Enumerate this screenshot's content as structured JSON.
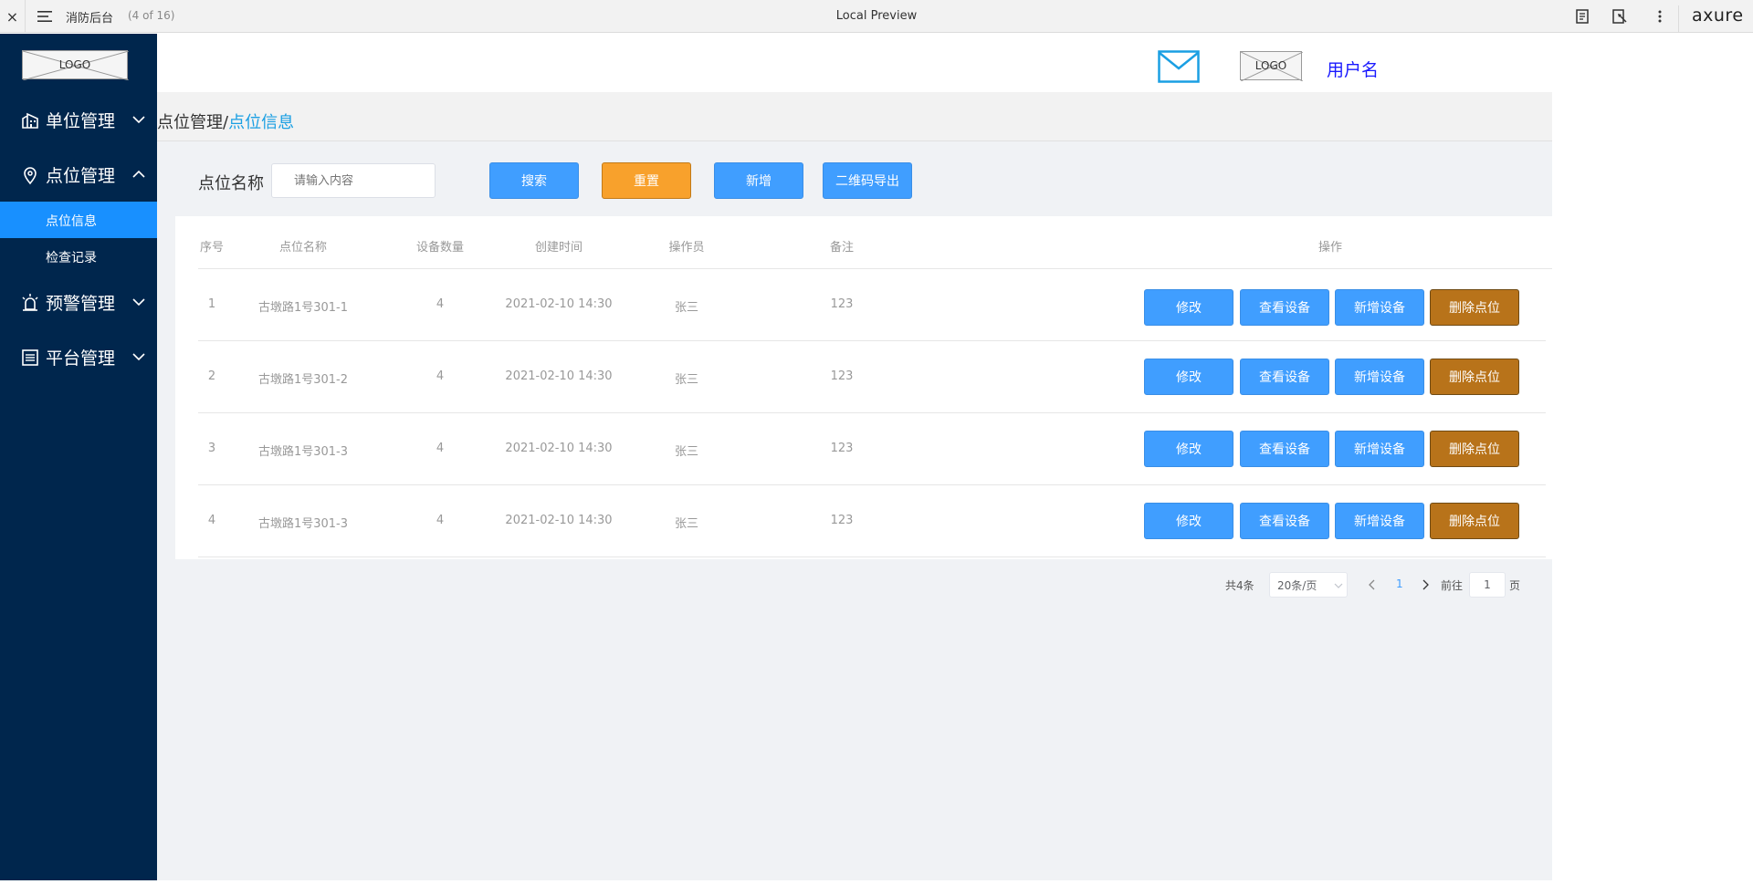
{
  "topbar": {
    "close": "×",
    "title": "消防后台",
    "page_count": "(4 of 16)",
    "center": "Local Preview",
    "brand": "axure"
  },
  "sidebar": {
    "logo": "LOGO",
    "groups": [
      {
        "label": "单位管理",
        "icon": "building-icon",
        "expanded": false
      },
      {
        "label": "点位管理",
        "icon": "location-pin-icon",
        "expanded": true
      },
      {
        "label": "预警管理",
        "icon": "alarm-icon",
        "expanded": false
      },
      {
        "label": "平台管理",
        "icon": "list-icon",
        "expanded": false
      }
    ],
    "sub_items": [
      {
        "label": "点位信息",
        "active": true
      },
      {
        "label": "检查记录",
        "active": false
      }
    ]
  },
  "header": {
    "logo": "LOGO",
    "username": "用户名"
  },
  "breadcrumb": {
    "parent": "点位管理",
    "separator": "/",
    "current": "点位信息"
  },
  "filter": {
    "label": "点位名称",
    "placeholder": "请输入内容",
    "search": "搜索",
    "reset": "重置",
    "add": "新增",
    "export": "二维码导出"
  },
  "table": {
    "headers": [
      "序号",
      "点位名称",
      "设备数量",
      "创建时间",
      "操作员",
      "备注",
      "操作"
    ],
    "rows": [
      {
        "no": "1",
        "name": "古墩路1号301-1",
        "count": "4",
        "time": "2021-02-10 14:30",
        "operator": "张三",
        "remark": "123"
      },
      {
        "no": "2",
        "name": "古墩路1号301-2",
        "count": "4",
        "time": "2021-02-10 14:30",
        "operator": "张三",
        "remark": "123"
      },
      {
        "no": "3",
        "name": "古墩路1号301-3",
        "count": "4",
        "time": "2021-02-10 14:30",
        "operator": "张三",
        "remark": "123"
      },
      {
        "no": "4",
        "name": "古墩路1号301-3",
        "count": "4",
        "time": "2021-02-10 14:30",
        "operator": "张三",
        "remark": "123"
      }
    ],
    "actions": {
      "edit": "修改",
      "view": "查看设备",
      "add_device": "新增设备",
      "delete": "删除点位"
    }
  },
  "pagination": {
    "total": "共4条",
    "page_size": "20条/页",
    "current": "1",
    "goto_label": "前往",
    "goto_value": "1",
    "page_suffix": "页"
  },
  "colors": {
    "sidebar": "#00264d",
    "active": "#1890ff",
    "primary": "#409eff",
    "reset": "#f8a12c",
    "delete": "#b8731a"
  }
}
